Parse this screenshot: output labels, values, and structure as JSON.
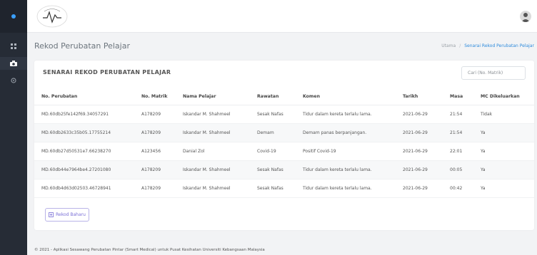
{
  "header": {
    "avatar_label": "User"
  },
  "page": {
    "title": "Rekod Perubatan Pelajar",
    "breadcrumb": [
      "Utama",
      "Senarai Rekod Perubatan Pelajar"
    ]
  },
  "card": {
    "title": "SENARAI REKOD PERUBATAN PELAJAR",
    "search_placeholder": "Cari (No. Matrik)"
  },
  "table": {
    "columns": [
      "No. Perubatan",
      "No. Matrik",
      "Nama Pelajar",
      "Rawatan",
      "Komen",
      "Tarikh",
      "Masa",
      "MC Dikeluarkan"
    ],
    "rows": [
      [
        "MD.60db25fe142f69.34057291",
        "A178209",
        "Iskandar M. Shahmeel",
        "Sesak Nafas",
        "Tidur dalam kereta terlalu lama.",
        "2021-06-29",
        "21:54",
        "Tidak"
      ],
      [
        "MD.60db2633c35b05.17755214",
        "A178209",
        "Iskandar M. Shahmeel",
        "Demam",
        "Demam panas berpanjangan.",
        "2021-06-29",
        "21:54",
        "Ya"
      ],
      [
        "MD.60db27d50531e7.66238270",
        "A123456",
        "Danial Zol",
        "Covid-19",
        "Positif Covid-19",
        "2021-06-29",
        "22:01",
        "Ya"
      ],
      [
        "MD.60db44e7964be4.27201080",
        "A178209",
        "Iskandar M. Shahmeel",
        "Sesak Nafas",
        "Tidur dalam kereta terlalu lama.",
        "2021-06-29",
        "00:05",
        "Ya"
      ],
      [
        "MD.60db4d63d02503.46728941",
        "A178209",
        "Iskandar M. Shahmeel",
        "Sesak Nafas",
        "Tidur dalam kereta terlalu lama.",
        "2021-06-29",
        "00:42",
        "Ya"
      ]
    ]
  },
  "actions": {
    "new_record_label": "Rekod Baharu"
  },
  "footer": {
    "text": "© 2021 - Aplikasi Sesawang Perubatan Pintar (Smart Medical) untuk Pusat Kesihatan Universiti Kebangsaan Malaysia"
  },
  "icons": {
    "sidebar": [
      "logo-icon",
      "grid-icon",
      "camera-icon",
      "settings-icon"
    ],
    "button": "plus-square-icon"
  },
  "colors": {
    "sidebar": "#262c36",
    "accent": "#2f8bdc",
    "button": "#7a6fd6"
  }
}
